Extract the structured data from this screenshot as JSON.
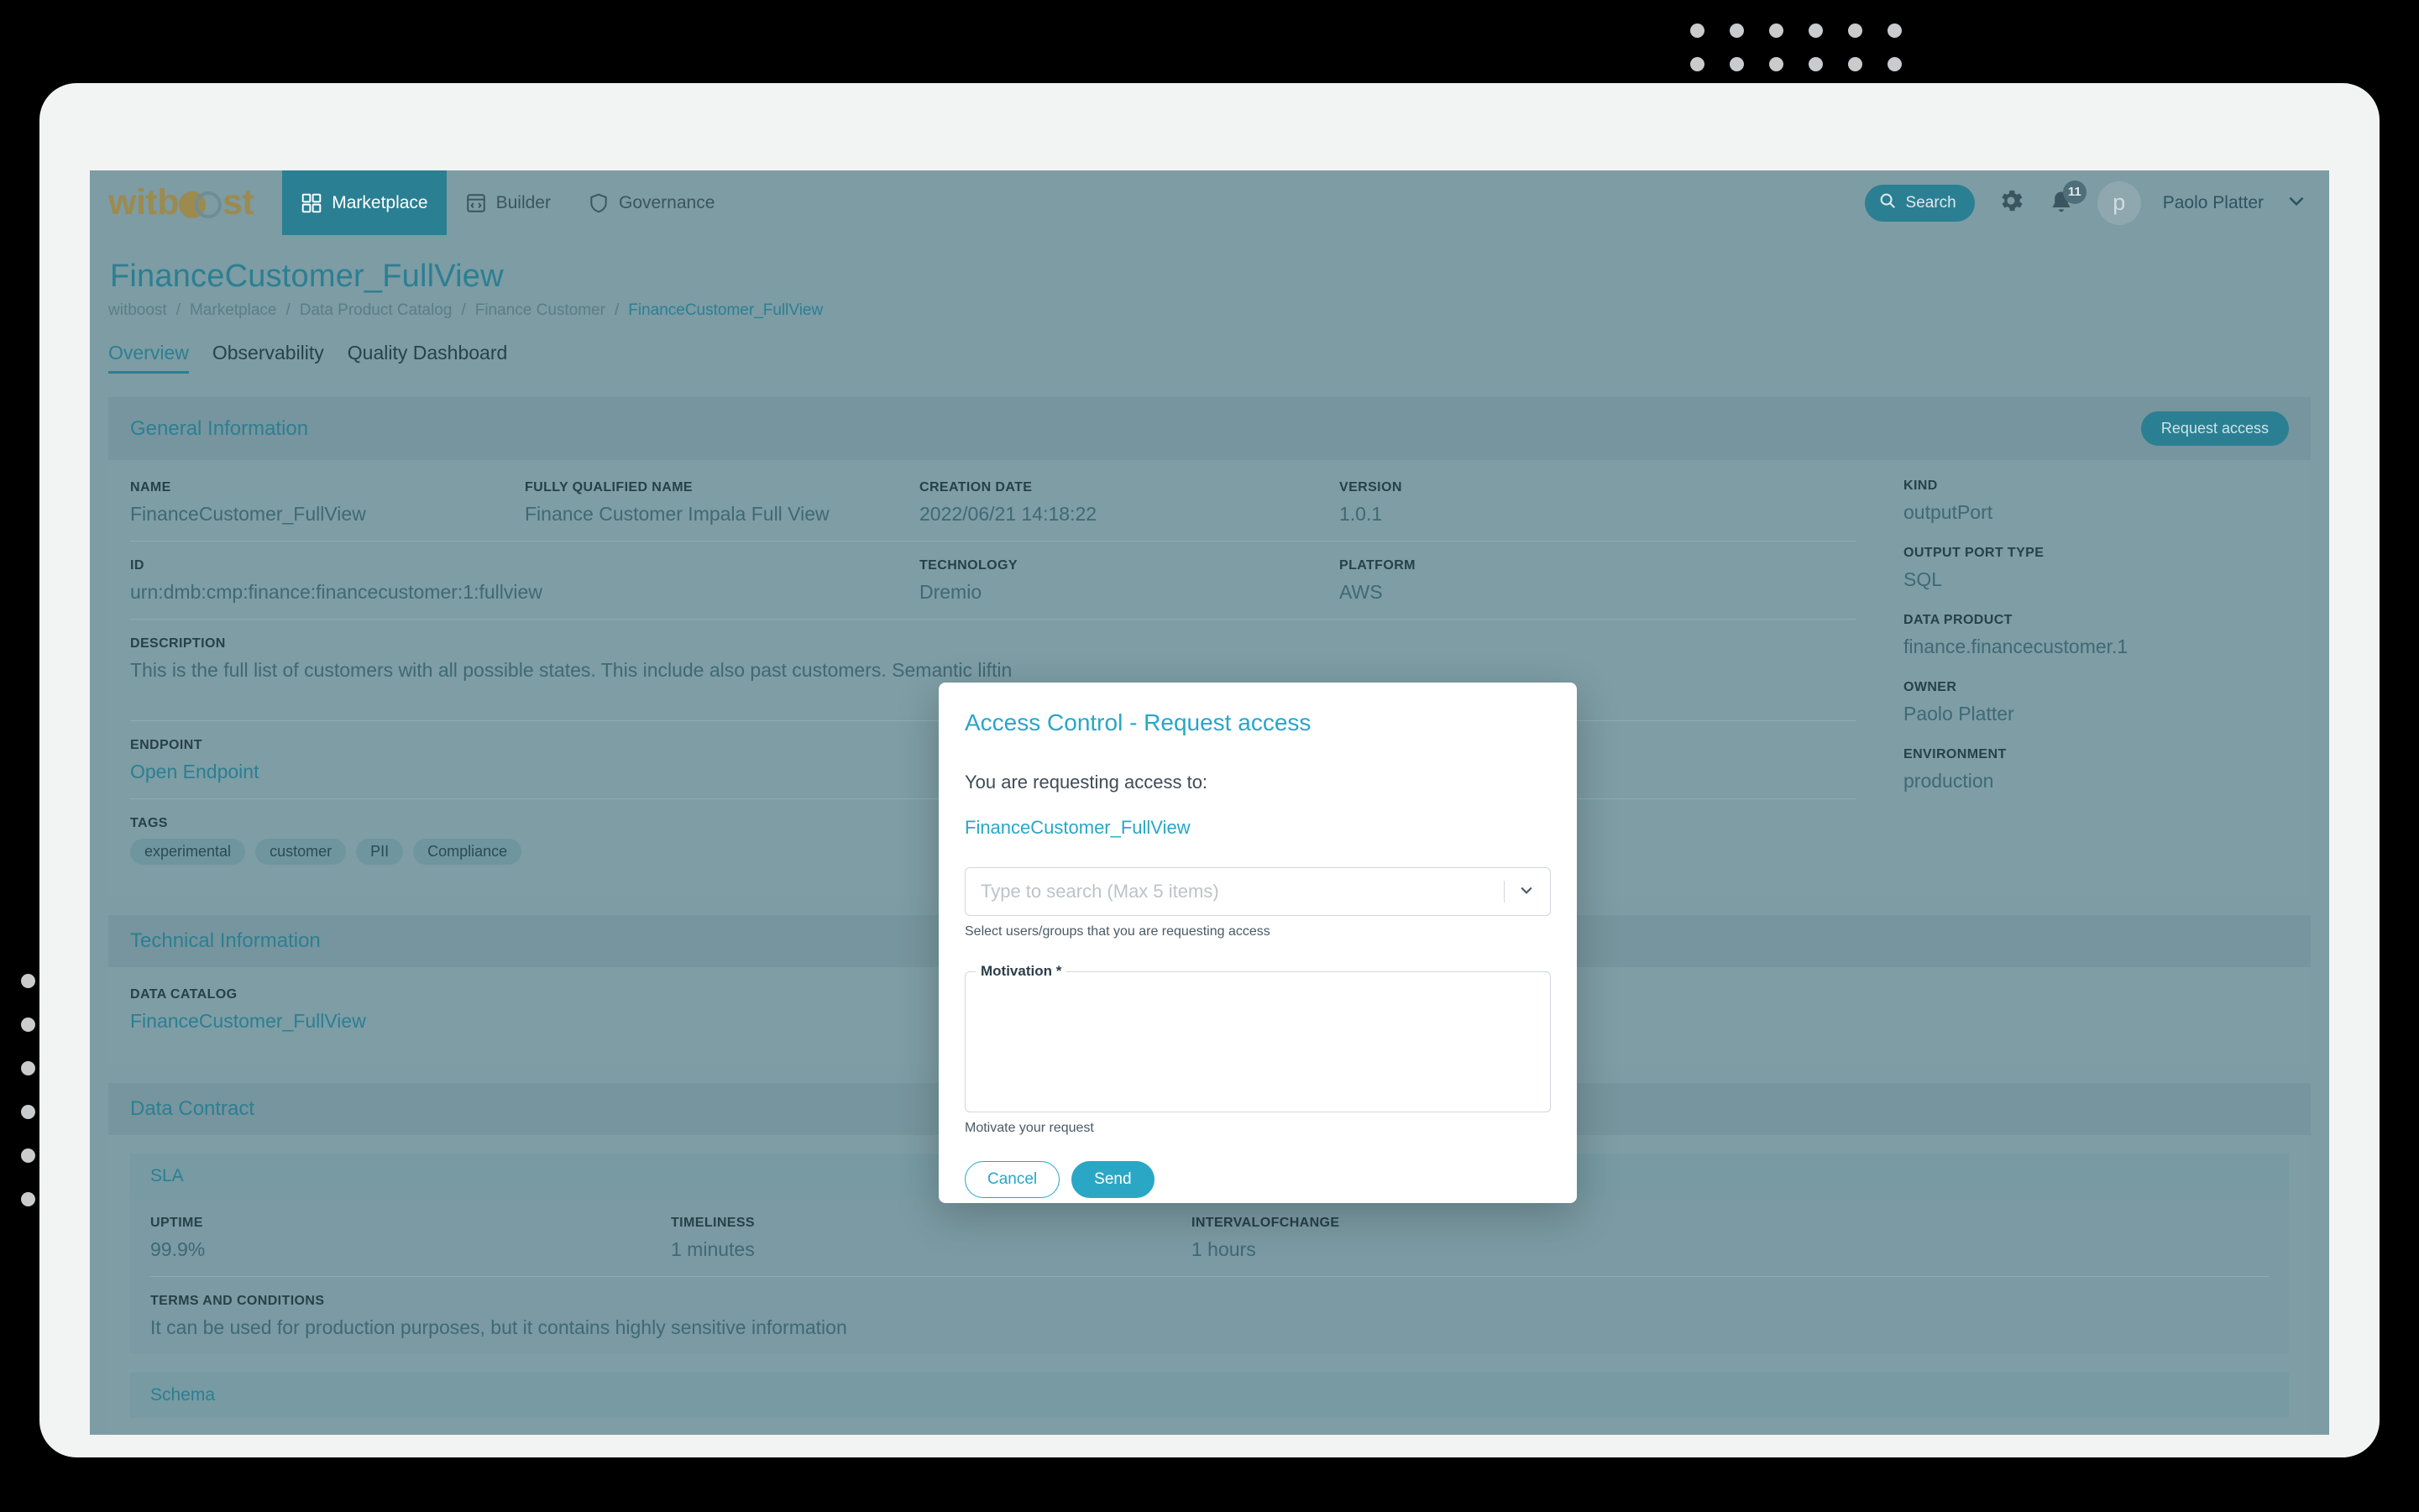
{
  "brand": {
    "logo_text_before": "witb",
    "logo_text_after": "st"
  },
  "topnav": {
    "items": [
      {
        "label": "Marketplace",
        "icon": "grid-icon",
        "active": true
      },
      {
        "label": "Builder",
        "icon": "code-window-icon",
        "active": false
      },
      {
        "label": "Governance",
        "icon": "shield-icon",
        "active": false
      }
    ],
    "search_label": "Search",
    "notification_count": "11",
    "avatar_initial": "p",
    "user_name": "Paolo Platter"
  },
  "page": {
    "title": "FinanceCustomer_FullView",
    "breadcrumb": [
      "witboost",
      "Marketplace",
      "Data Product Catalog",
      "Finance Customer",
      "FinanceCustomer_FullView"
    ],
    "tabs": [
      {
        "label": "Overview",
        "active": true
      },
      {
        "label": "Observability",
        "active": false
      },
      {
        "label": "Quality Dashboard",
        "active": false
      }
    ]
  },
  "general_information": {
    "heading": "General Information",
    "request_access_label": "Request access",
    "fields": [
      {
        "label": "NAME",
        "value": "FinanceCustomer_FullView"
      },
      {
        "label": "FULLY QUALIFIED NAME",
        "value": "Finance Customer Impala Full View"
      },
      {
        "label": "CREATION DATE",
        "value": "2022/06/21 14:18:22"
      },
      {
        "label": "VERSION",
        "value": "1.0.1"
      },
      {
        "label": "ID",
        "value": "urn:dmb:cmp:finance:financecustomer:1:fullview"
      },
      {
        "label": "TECHNOLOGY",
        "value": "Dremio"
      },
      {
        "label": "PLATFORM",
        "value": "AWS"
      }
    ],
    "description_label": "DESCRIPTION",
    "description_value": "This is the full list of customers with all possible states. This include also past customers. Semantic liftin",
    "endpoint_label": "ENDPOINT",
    "endpoint_value": "Open Endpoint",
    "tags_label": "TAGS",
    "tags": [
      "experimental",
      "customer",
      "PII",
      "Compliance"
    ]
  },
  "meta": [
    {
      "label": "KIND",
      "value": "outputPort"
    },
    {
      "label": "OUTPUT PORT TYPE",
      "value": "SQL"
    },
    {
      "label": "DATA PRODUCT",
      "value": "finance.financecustomer.1"
    },
    {
      "label": "OWNER",
      "value": "Paolo Platter"
    },
    {
      "label": "ENVIRONMENT",
      "value": "production"
    }
  ],
  "technical_information": {
    "heading": "Technical Information",
    "data_catalog_label": "DATA CATALOG",
    "data_catalog_value": "FinanceCustomer_FullView"
  },
  "data_contract": {
    "heading": "Data Contract",
    "sla_heading": "SLA",
    "sla": [
      {
        "label": "UPTIME",
        "value": "99.9%"
      },
      {
        "label": "TIMELINESS",
        "value": "1 minutes"
      },
      {
        "label": "INTERVALOFCHANGE",
        "value": "1 hours"
      }
    ],
    "terms_label": "TERMS AND CONDITIONS",
    "terms_value": "It can be used for production purposes, but it contains highly sensitive information"
  },
  "schema": {
    "heading": "Schema"
  },
  "modal": {
    "title": "Access Control - Request access",
    "lead": "You are requesting access to:",
    "target": "FinanceCustomer_FullView",
    "search_placeholder": "Type to search (Max 5 items)",
    "search_value": "",
    "search_hint": "Select users/groups that you are requesting access",
    "motivation_label": "Motivation *",
    "motivation_value": "",
    "motivation_hint": "Motivate your request",
    "cancel_label": "Cancel",
    "send_label": "Send"
  },
  "colors": {
    "accent_teal": "#2b7f92",
    "page_bg": "#7d9ca4",
    "modal_accent": "#28a6c8",
    "logo_gold": "#9c8a4f"
  }
}
